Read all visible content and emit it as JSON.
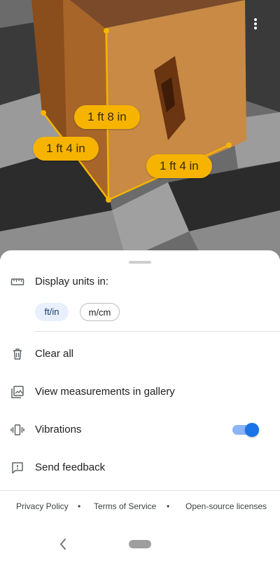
{
  "camera": {
    "measurements": [
      {
        "label": "1 ft 8 in"
      },
      {
        "label": "1 ft 4 in"
      },
      {
        "label": "1 ft 4 in"
      }
    ],
    "accent_color": "#f6b400"
  },
  "sheet": {
    "display_units_label": "Display units in:",
    "units": [
      {
        "label": "ft/in",
        "selected": true
      },
      {
        "label": "m/cm",
        "selected": false
      }
    ],
    "menu": {
      "clear_all": "Clear all",
      "view_gallery": "View measurements in gallery",
      "vibrations": "Vibrations",
      "vibrations_on": true,
      "send_feedback": "Send feedback"
    },
    "footer": {
      "privacy": "Privacy Policy",
      "separator": "•",
      "terms": "Terms of Service",
      "licenses": "Open-source licenses"
    }
  },
  "colors": {
    "toggle_on": "#1a73e8",
    "selected_chip": "#e8f0fe"
  }
}
